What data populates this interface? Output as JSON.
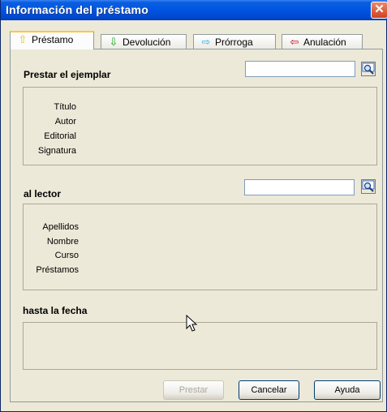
{
  "window": {
    "title": "Información del préstamo",
    "close_glyph": "✕"
  },
  "tabs": [
    {
      "label": "Préstamo",
      "icon": "arrow-up-icon",
      "glyph": "⇧",
      "color": "#e8c000",
      "active": true
    },
    {
      "label": "Devolución",
      "icon": "arrow-down-icon",
      "glyph": "⇩",
      "color": "#1aa81a",
      "active": false
    },
    {
      "label": "Prórroga",
      "icon": "arrow-right-icon",
      "glyph": "⇨",
      "color": "#21b6e6",
      "active": false
    },
    {
      "label": "Anulación",
      "icon": "arrow-left-icon",
      "glyph": "⇦",
      "color": "#c8001e",
      "active": false
    }
  ],
  "ejemplar": {
    "heading": "Prestar el ejemplar",
    "input_value": "",
    "fields": [
      "Título",
      "Autor",
      "Editorial",
      "Signatura"
    ]
  },
  "lector": {
    "heading": "al lector",
    "input_value": "",
    "fields": [
      "Apellidos",
      "Nombre",
      "Curso",
      "Préstamos"
    ]
  },
  "fecha": {
    "heading": "hasta la fecha"
  },
  "buttons": {
    "prestar": "Prestar",
    "cancelar": "Cancelar",
    "ayuda": "Ayuda"
  },
  "colors": {
    "titlebar": "#0054e3",
    "close": "#d1421d",
    "active_tab_highlight": "#ffc83c"
  }
}
